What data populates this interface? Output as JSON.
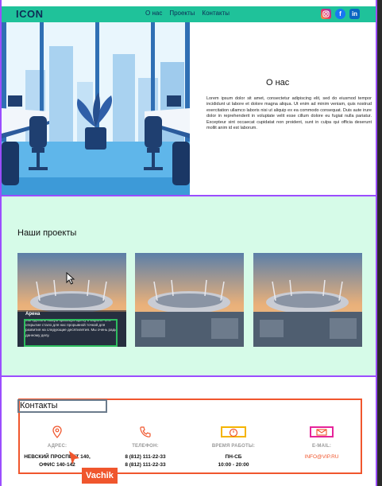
{
  "header": {
    "logo": "ICON",
    "nav": [
      "О нас",
      "Проекты",
      "Контакты"
    ],
    "social": [
      "instagram-icon",
      "facebook-icon",
      "linkedin-icon"
    ]
  },
  "about": {
    "title": "О нас",
    "text": "Lorem ipsum dolor sit amet, consectetur adipiscing elit, sed do eiusmod tempor incididunt ut labore et dolore magna aliqua. Ut enim ad minim veniam, quis nostrud exercitation ullamco laboris nisi ut aliquip ex ea commodo consequat. Duis aute irure dolor in reprehenderit in voluptate velit esse cillum dolore eu fugiat nulla pariatur. Excepteur sint occaecat cupidatat non proident, sunt in culpa qui officia deserunt mollit anim id est laborum."
  },
  "projects": {
    "title": "Наши проекты",
    "cards": [
      {
        "name": "Арена",
        "desc": "Мы сделали самую красивую арену в Европе. Это открытие стало для нас прорывной точкой для развития на следующие десятилетия. Мы очень рады данному делу."
      },
      {
        "name": "",
        "desc": ""
      },
      {
        "name": "",
        "desc": ""
      }
    ]
  },
  "contacts": {
    "title": "Контакты",
    "items": [
      {
        "icon": "location-pin-icon",
        "label": "АДРЕС:",
        "value_line1": "НЕВСКИЙ ПРОСПЕКТ 140,",
        "value_line2": "ОФИС 140-142"
      },
      {
        "icon": "phone-icon",
        "label": "ТЕЛЕФОН:",
        "value_line1": "8 (812) 111-22-33",
        "value_line2": "8 (812) 111-22-33"
      },
      {
        "icon": "clock-icon",
        "label": "ВРЕМЯ РАБОТЫ:",
        "value_line1": "ПН-СБ",
        "value_line2": "10:00 - 20:00"
      },
      {
        "icon": "email-icon",
        "label": "E-MAIL:",
        "value_line1": "INFO@VIP.RU",
        "value_line2": ""
      }
    ]
  },
  "overlay": {
    "user_tag": "Vachik"
  },
  "colors": {
    "header_bg": "#1fc29a",
    "projects_bg": "#d6fbe8",
    "accent": "#f0562d",
    "frame": "#9b4dff",
    "logo": "#0d2c55"
  }
}
